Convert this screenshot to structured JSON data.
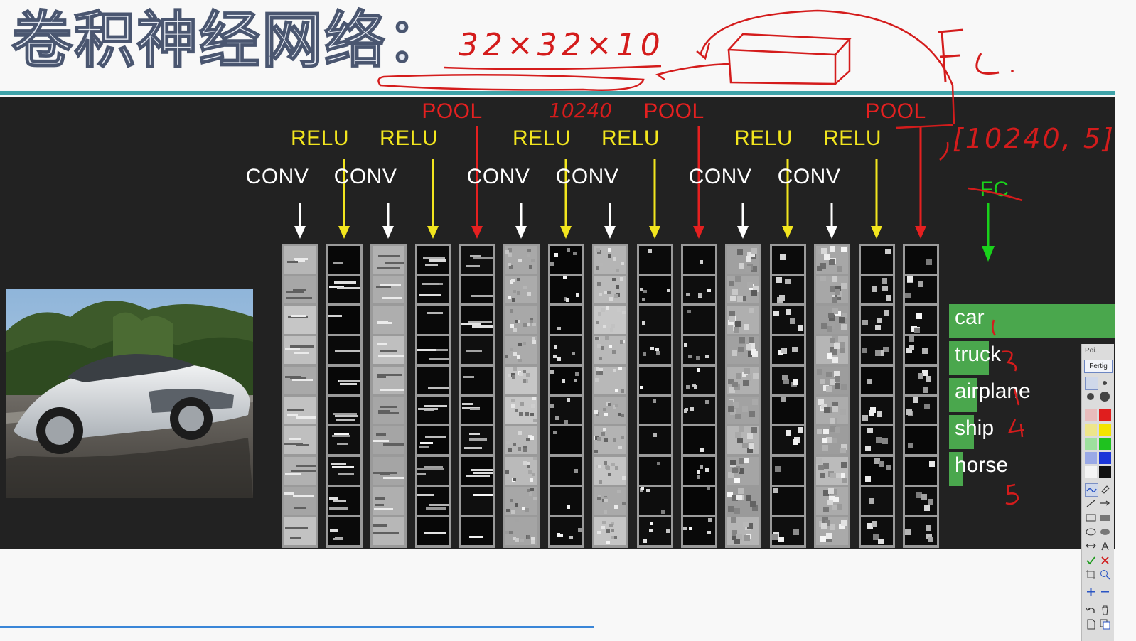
{
  "slide": {
    "title": "卷积神经网络："
  },
  "labels": {
    "conv": "CONV",
    "relu": "RELU",
    "pool": "POOL",
    "fc": "FC"
  },
  "classes": [
    {
      "label": "car",
      "score": 1.0
    },
    {
      "label": "truck",
      "score": 0.24
    },
    {
      "label": "airplane",
      "score": 0.17
    },
    {
      "label": "ship",
      "score": 0.15
    },
    {
      "label": "horse",
      "score": 0.08
    }
  ],
  "annotations": {
    "dims": "32×32×10",
    "size": "10240",
    "matrix": "[10240, 5]",
    "fc": "FC"
  },
  "palette": {
    "title": "Poi...",
    "done_label": "Fertig"
  },
  "colors": {
    "accent_rule": "#3fa3a9",
    "conv": "#ffffff",
    "relu": "#f2e51e",
    "pool": "#e52020",
    "fc": "#19d21b",
    "class_bar": "#4aa74d",
    "ink": "#d41c1c"
  }
}
